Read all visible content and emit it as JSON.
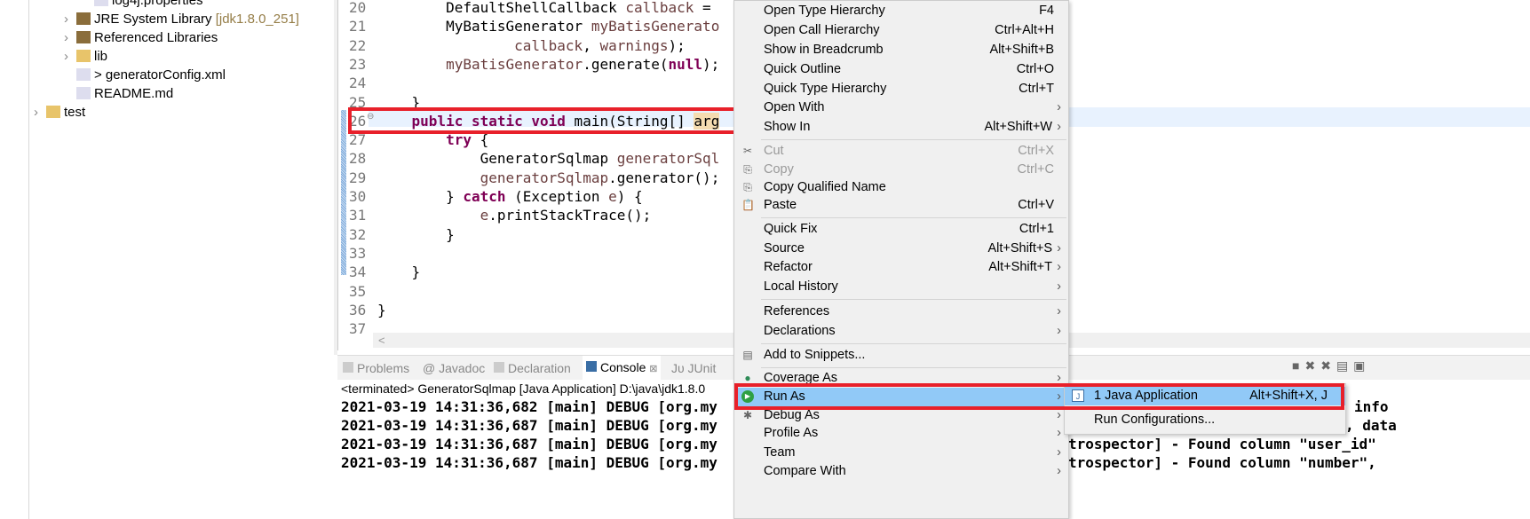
{
  "explorer": {
    "items": [
      {
        "label": "log4j.properties",
        "icon": "properties-file-icon"
      },
      {
        "label": "JRE System Library",
        "decoration": "[jdk1.8.0_251]",
        "icon": "library-icon"
      },
      {
        "label": "Referenced Libraries",
        "icon": "library-icon"
      },
      {
        "label": "lib",
        "icon": "folder-icon"
      },
      {
        "label": "> generatorConfig.xml",
        "icon": "xml-file-icon"
      },
      {
        "label": "README.md",
        "icon": "file-icon"
      },
      {
        "label": "test",
        "icon": "project-folder-icon"
      }
    ]
  },
  "editor": {
    "lines": [
      {
        "n": "20",
        "code": [
          [
            "",
            "        DefaultShellCallback "
          ],
          [
            "var",
            "callback"
          ],
          [
            "",
            " = "
          ]
        ]
      },
      {
        "n": "21",
        "code": [
          [
            "",
            "        MyBatisGenerator "
          ],
          [
            "var",
            "myBatisGenerato"
          ]
        ]
      },
      {
        "n": "22",
        "code": [
          [
            "",
            "                "
          ],
          [
            "var",
            "callback"
          ],
          [
            "",
            ", "
          ],
          [
            "var",
            "warnings"
          ],
          [
            "",
            ");"
          ]
        ]
      },
      {
        "n": "23",
        "code": [
          [
            "",
            "        "
          ],
          [
            "var",
            "myBatisGenerator"
          ],
          [
            "",
            ".generate("
          ],
          [
            "kw",
            "null"
          ],
          [
            "",
            "); "
          ]
        ]
      },
      {
        "n": "24",
        "code": []
      },
      {
        "n": "25",
        "code": [
          [
            "",
            "    }"
          ]
        ]
      },
      {
        "n": "26",
        "code": [
          [
            "",
            "    "
          ],
          [
            "kw",
            "public static void"
          ],
          [
            "",
            " main(String[] "
          ],
          [
            "hl",
            "arg"
          ]
        ]
      },
      {
        "n": "27",
        "code": [
          [
            "",
            "        "
          ],
          [
            "kw",
            "try"
          ],
          [
            "",
            " {"
          ]
        ]
      },
      {
        "n": "28",
        "code": [
          [
            "",
            "            GeneratorSqlmap "
          ],
          [
            "var",
            "generatorSql"
          ]
        ]
      },
      {
        "n": "29",
        "code": [
          [
            "",
            "            "
          ],
          [
            "var",
            "generatorSqlmap"
          ],
          [
            "",
            ".generator();"
          ]
        ]
      },
      {
        "n": "30",
        "code": [
          [
            "",
            "        } "
          ],
          [
            "kw",
            "catch"
          ],
          [
            "",
            " (Exception "
          ],
          [
            "var",
            "e"
          ],
          [
            "",
            ") {"
          ]
        ]
      },
      {
        "n": "31",
        "code": [
          [
            "",
            "            "
          ],
          [
            "var",
            "e"
          ],
          [
            "",
            ".printStackTrace();"
          ]
        ]
      },
      {
        "n": "32",
        "code": [
          [
            "",
            "        }"
          ]
        ]
      },
      {
        "n": "33",
        "code": []
      },
      {
        "n": "34",
        "code": [
          [
            "",
            "    }"
          ]
        ]
      },
      {
        "n": "35",
        "code": []
      },
      {
        "n": "36",
        "code": [
          [
            "",
            "}"
          ]
        ]
      },
      {
        "n": "37",
        "code": []
      }
    ],
    "scroll_left": "<"
  },
  "bottom": {
    "tabs": [
      {
        "label": "Problems",
        "icon": "problems-icon",
        "active": false
      },
      {
        "label": "@ Javadoc",
        "icon": "",
        "active": false
      },
      {
        "label": "Declaration",
        "icon": "declaration-icon",
        "active": false
      },
      {
        "label": "Console",
        "icon": "console-icon",
        "active": true,
        "close": "⊠"
      },
      {
        "label": "Jυ JUnit",
        "icon": "",
        "active": false
      }
    ],
    "console_header": "<terminated> GeneratorSqlmap [Java Application] D:\\java\\jdk1.8.0",
    "console_lines": [
      {
        "left": "2021-03-19 14:31:36,682 [main] DEBUG [org.my",
        "right": "info"
      },
      {
        "left": "2021-03-19 14:31:36,687 [main] DEBUG [org.my",
        "right": ", data"
      },
      {
        "left": "2021-03-19 14:31:36,687 [main] DEBUG [org.my",
        "right": "trospector] - Found column \"user_id\""
      },
      {
        "left": "2021-03-19 14:31:36,687 [main] DEBUG [org.my",
        "right": "trospector] - Found column \"number\","
      }
    ]
  },
  "context_menu": {
    "items": [
      {
        "label": "Open Type Hierarchy",
        "shortcut": "F4"
      },
      {
        "label": "Open Call Hierarchy",
        "shortcut": "Ctrl+Alt+H"
      },
      {
        "label": "Show in Breadcrumb",
        "shortcut": "Alt+Shift+B"
      },
      {
        "label": "Quick Outline",
        "shortcut": "Ctrl+O"
      },
      {
        "label": "Quick Type Hierarchy",
        "shortcut": "Ctrl+T"
      },
      {
        "label": "Open With",
        "submenu": true
      },
      {
        "label": "Show In",
        "shortcut": "Alt+Shift+W",
        "submenu": true
      },
      {
        "sep": true
      },
      {
        "label": "Cut",
        "shortcut": "Ctrl+X",
        "disabled": true,
        "icon": "cut-icon"
      },
      {
        "label": "Copy",
        "shortcut": "Ctrl+C",
        "disabled": true,
        "icon": "copy-icon"
      },
      {
        "label": "Copy Qualified Name",
        "icon": "copy-icon"
      },
      {
        "label": "Paste",
        "shortcut": "Ctrl+V",
        "icon": "paste-icon"
      },
      {
        "sep": true
      },
      {
        "label": "Quick Fix",
        "shortcut": "Ctrl+1"
      },
      {
        "label": "Source",
        "shortcut": "Alt+Shift+S",
        "submenu": true
      },
      {
        "label": "Refactor",
        "shortcut": "Alt+Shift+T",
        "submenu": true
      },
      {
        "label": "Local History",
        "submenu": true
      },
      {
        "sep": true
      },
      {
        "label": "References",
        "submenu": true
      },
      {
        "label": "Declarations",
        "submenu": true
      },
      {
        "sep": true
      },
      {
        "label": "Add to Snippets...",
        "icon": "snippet-icon"
      },
      {
        "sep": true
      },
      {
        "label": "Coverage As",
        "submenu": true,
        "icon": "coverage-icon"
      },
      {
        "label": "Run As",
        "submenu": true,
        "icon": "run-icon",
        "selected": true
      },
      {
        "label": "Debug As",
        "submenu": true,
        "icon": "debug-icon"
      },
      {
        "label": "Profile As",
        "submenu": true
      },
      {
        "label": "Team",
        "submenu": true
      },
      {
        "label": "Compare With",
        "submenu": true
      }
    ]
  },
  "run_as_submenu": {
    "items": [
      {
        "label": "1 Java Application",
        "shortcut": "Alt+Shift+X, J",
        "icon": "java-app-icon"
      },
      {
        "label": "Run Configurations..."
      }
    ]
  },
  "colors": {
    "highlight_box": "#e8202a",
    "menu_selected": "#91c9f7",
    "keyword": "#7f0055"
  }
}
